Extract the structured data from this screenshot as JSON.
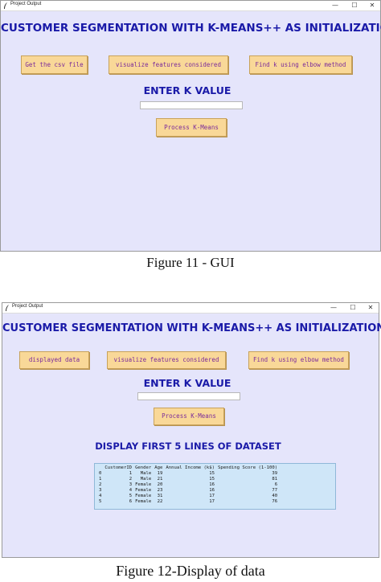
{
  "fig1": {
    "window_title": "Project Output",
    "controls": [
      "—",
      "☐",
      "✕"
    ],
    "heading": "CUSTOMER SEGMENTATION WITH K-MEANS++ AS INITIALIZATION",
    "buttons": [
      "Get the csv file",
      "visualize features considered",
      "Find k using elbow method"
    ],
    "k_label": "ENTER K VALUE",
    "k_value": "",
    "process_label": "Process K-Means",
    "caption": "Figure 11 -  GUI"
  },
  "fig2": {
    "window_title": "Project Output",
    "controls": [
      "—",
      "☐",
      "✕"
    ],
    "heading": "CUSTOMER SEGMENTATION WITH K-MEANS++ AS INITIALIZATION",
    "buttons": [
      "displayed data",
      "visualize features considered",
      "Find k using elbow method"
    ],
    "k_label": "ENTER K VALUE",
    "k_value": "",
    "process_label": "Process K-Means",
    "display_heading": "DISPLAY FIRST 5 LINES OF DATASET",
    "table": {
      "headers": [
        "",
        "CustomerID",
        "Gender",
        "Age",
        "Annual Income (k$)",
        "Spending Score (1-100)"
      ],
      "rows": [
        [
          "0",
          "1",
          "Male",
          "19",
          "15",
          "39"
        ],
        [
          "1",
          "2",
          "Male",
          "21",
          "15",
          "81"
        ],
        [
          "2",
          "3",
          "Female",
          "20",
          "16",
          "6"
        ],
        [
          "3",
          "4",
          "Female",
          "23",
          "16",
          "77"
        ],
        [
          "4",
          "5",
          "Female",
          "31",
          "17",
          "40"
        ],
        [
          "5",
          "6",
          "Female",
          "22",
          "17",
          "76"
        ]
      ]
    },
    "caption": "Figure 12-Display of data"
  },
  "colors": {
    "window_bg": "#e5e5fb",
    "heading": "#1a1aa8",
    "button_bg": "#f9d898",
    "button_text": "#7a2a9a",
    "table_bg": "#cfe6f8"
  }
}
